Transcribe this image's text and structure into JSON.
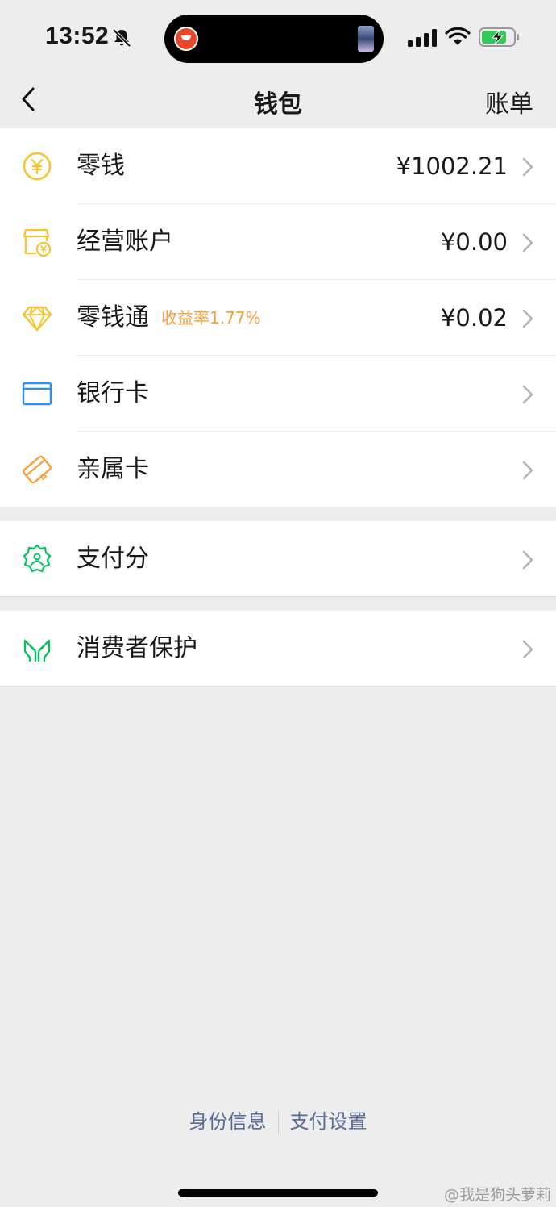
{
  "status_bar": {
    "time": "13:52"
  },
  "nav": {
    "title": "钱包",
    "right_label": "账单"
  },
  "wallet_items": [
    {
      "label": "零钱",
      "value": "¥1002.21",
      "icon": "coin-yen-icon",
      "color": "#f7c32e"
    },
    {
      "label": "经营账户",
      "value": "¥0.00",
      "icon": "shop-account-icon",
      "color": "#f7c32e"
    },
    {
      "label": "零钱通",
      "badge": "收益率1.77%",
      "value": "¥0.02",
      "icon": "diamond-icon",
      "color": "#f7c32e"
    },
    {
      "label": "银行卡",
      "icon": "bank-card-icon",
      "color": "#2f8ff0"
    },
    {
      "label": "亲属卡",
      "icon": "family-card-icon",
      "color": "#fa9d3b"
    }
  ],
  "payscore": {
    "label": "支付分",
    "icon": "payscore-badge-icon",
    "color": "#07c160"
  },
  "consumer": {
    "label": "消费者保护",
    "icon": "protect-hands-icon",
    "color": "#07c160"
  },
  "footer": {
    "identity": "身份信息",
    "settings": "支付设置"
  },
  "watermark": "@我是狗头萝莉"
}
